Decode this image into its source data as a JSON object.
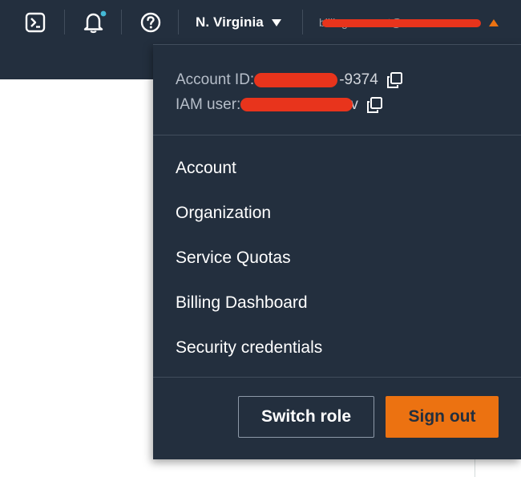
{
  "topbar": {
    "cloudshell_icon": "terminal-icon",
    "notifications_icon": "bell-icon",
    "notification_badge_color": "#44b9d6",
    "help_icon": "question-circle-icon",
    "region_label": "N. Virginia",
    "region_caret_icon": "caret-down-icon",
    "account_menu_label": "billing-account@...",
    "account_menu_caret_icon": "caret-up-icon",
    "account_menu_caret_color": "#ec7211"
  },
  "dropdown": {
    "account_id_label": "Account ID: ",
    "account_id_visible_suffix": "-9374",
    "iam_user_label": "IAM user: ",
    "iam_user_visible_suffix": "v",
    "copy_icon": "copy-icon",
    "menu_items": [
      {
        "label": "Account"
      },
      {
        "label": "Organization"
      },
      {
        "label": "Service Quotas"
      },
      {
        "label": "Billing Dashboard"
      },
      {
        "label": "Security credentials"
      }
    ],
    "switch_role_label": "Switch role",
    "sign_out_label": "Sign out"
  },
  "colors": {
    "nav_bg": "#232f3e",
    "accent_orange": "#ec7211",
    "redaction_red": "#e8341c"
  }
}
